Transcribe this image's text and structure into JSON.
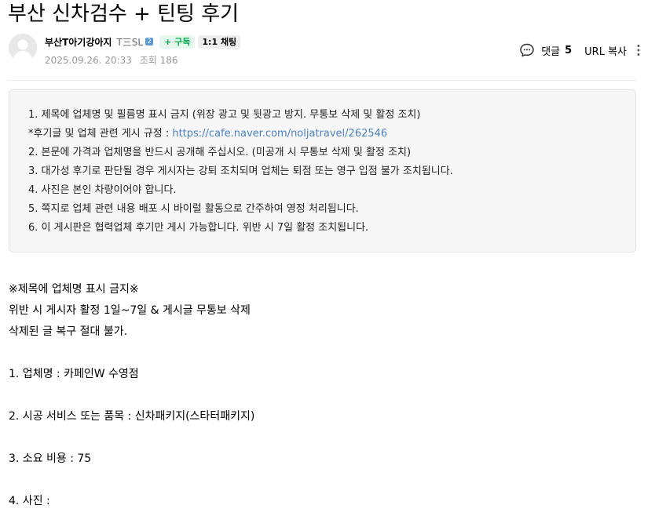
{
  "post": {
    "title": "부산 신차검수 + 틴팅 후기"
  },
  "author": {
    "name": "부산T아기강아지",
    "grade": "T三SL",
    "grade_badge": "2",
    "subscribe_label": "+ 구독",
    "chat_label": "1:1 채팅",
    "date": "2025.09.26. 20:33",
    "views": "조회 186"
  },
  "actions": {
    "comment_label": "댓글",
    "comment_count": "5",
    "url_copy_label": "URL 복사"
  },
  "notice": {
    "line1": "1. 제목에 업체명 및 필름명 표시 금지 (위장 광고 및 뒷광고 방지. 무통보 삭제 및 활정 조치)",
    "line2_prefix": "*후기글 및 업체 관련 게시 규정 : ",
    "line2_link": "https://cafe.naver.com/noljatravel/262546",
    "line3": "2. 본문에 가격과 업체명을 반드시 공개해 주십시오. (미공개 시 무통보 삭제 및 활정 조치)",
    "line4": "3. 대가성 후기로 판단될 경우 게시자는 강퇴 조치되며 업체는 퇴점 또는 영구 입점 불가 조치됩니다.",
    "line5": "4. 사진은 본인 차량이어야 합니다.",
    "line6": "5. 쪽지로 업체 관련 내용 배포 시 바이럴 활동으로 간주하여 영정 처리됩니다.",
    "line7": "6. 이 게시판은 협력업체 후기만 게시 가능합니다. 위반 시 7일 활정 조치됩니다."
  },
  "body": {
    "warning_title": "※제목에 업체명 표시 금지※",
    "warning_line1": "위반 시 게시자 활정 1일~7일 & 게시글 무통보 삭제",
    "warning_line2": "삭제된 글 복구 절대 불가.",
    "item1": "1. 업체명 : 카페인W 수영점",
    "item2": "2. 시공 서비스 또는 품목 : 신차패키지(스타터패키지)",
    "item3": "3. 소요 비용 :  75",
    "item4": "4. 사진 :"
  }
}
